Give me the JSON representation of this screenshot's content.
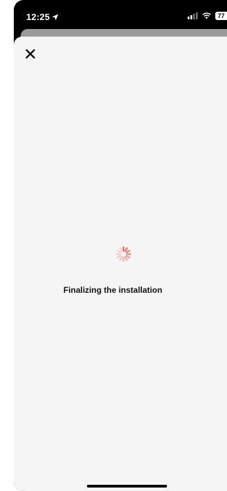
{
  "status_bar": {
    "time": "12:25",
    "battery_level": "77",
    "location_icon": "location-arrow-icon",
    "signal_icon": "cellular-signal-icon",
    "wifi_icon": "wifi-icon"
  },
  "sheet": {
    "close_icon": "close-icon",
    "loading_icon": "loading-spinner-icon",
    "message": "Finalizing the installation"
  },
  "colors": {
    "spinner": "#e8665f",
    "sheet_background": "#f5f5f5",
    "text": "#111111"
  }
}
